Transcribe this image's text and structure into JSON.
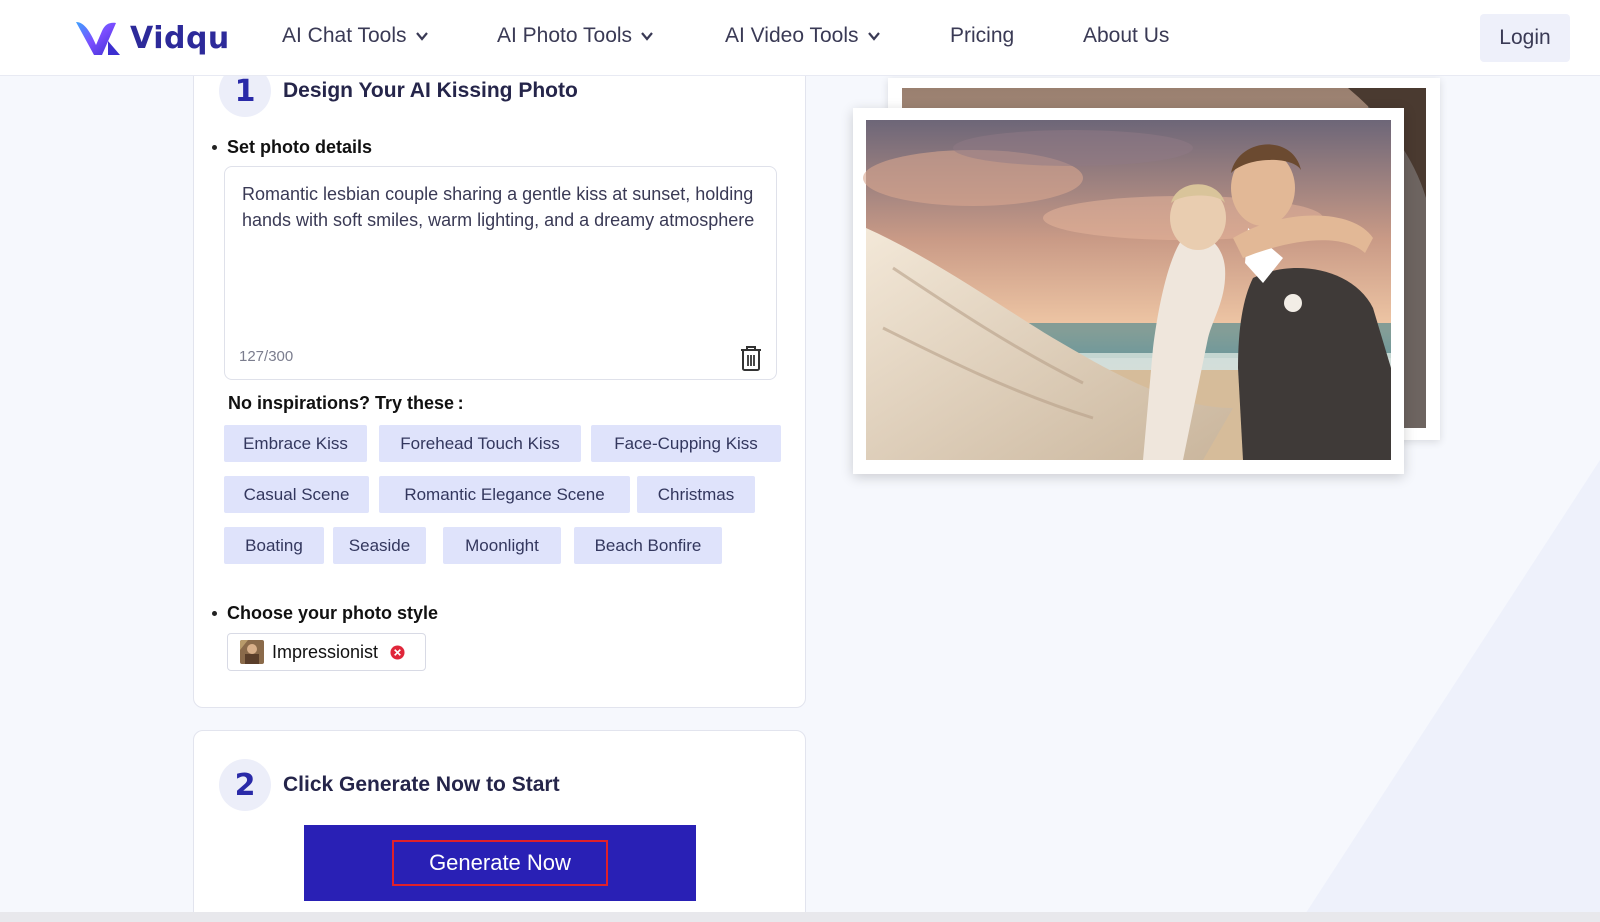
{
  "header": {
    "brand": "Vidqu",
    "nav": [
      {
        "label": "AI Chat Tools",
        "has_dropdown": true
      },
      {
        "label": "AI Photo Tools",
        "has_dropdown": true
      },
      {
        "label": "AI Video Tools",
        "has_dropdown": true
      },
      {
        "label": "Pricing",
        "has_dropdown": false
      },
      {
        "label": "About Us",
        "has_dropdown": false
      }
    ],
    "login_label": "Login"
  },
  "step1": {
    "number": "1",
    "title": "Design Your AI Kissing Photo",
    "details_label": "Set photo details",
    "prompt_text": "Romantic lesbian couple sharing a gentle kiss at sunset, holding hands with soft smiles, warm lighting, and a dreamy atmosphere",
    "counter": "127/300",
    "inspirations_label": "No inspirations?  Try these :",
    "inspirations": [
      "Embrace Kiss",
      "Forehead Touch Kiss",
      "Face-Cupping Kiss",
      "Casual Scene",
      "Romantic Elegance Scene",
      "Christmas",
      "Boating",
      "Seaside",
      "Moonlight",
      "Beach Bonfire"
    ],
    "style_label": "Choose your photo style",
    "selected_style": "Impressionist"
  },
  "step2": {
    "number": "2",
    "title": "Click Generate Now to Start",
    "button_label": "Generate Now"
  },
  "colors": {
    "brand": "#2d2a9a",
    "chip_bg": "#dfe3fb",
    "generate_bg": "#2920b5",
    "highlight_border": "#e0202a"
  }
}
